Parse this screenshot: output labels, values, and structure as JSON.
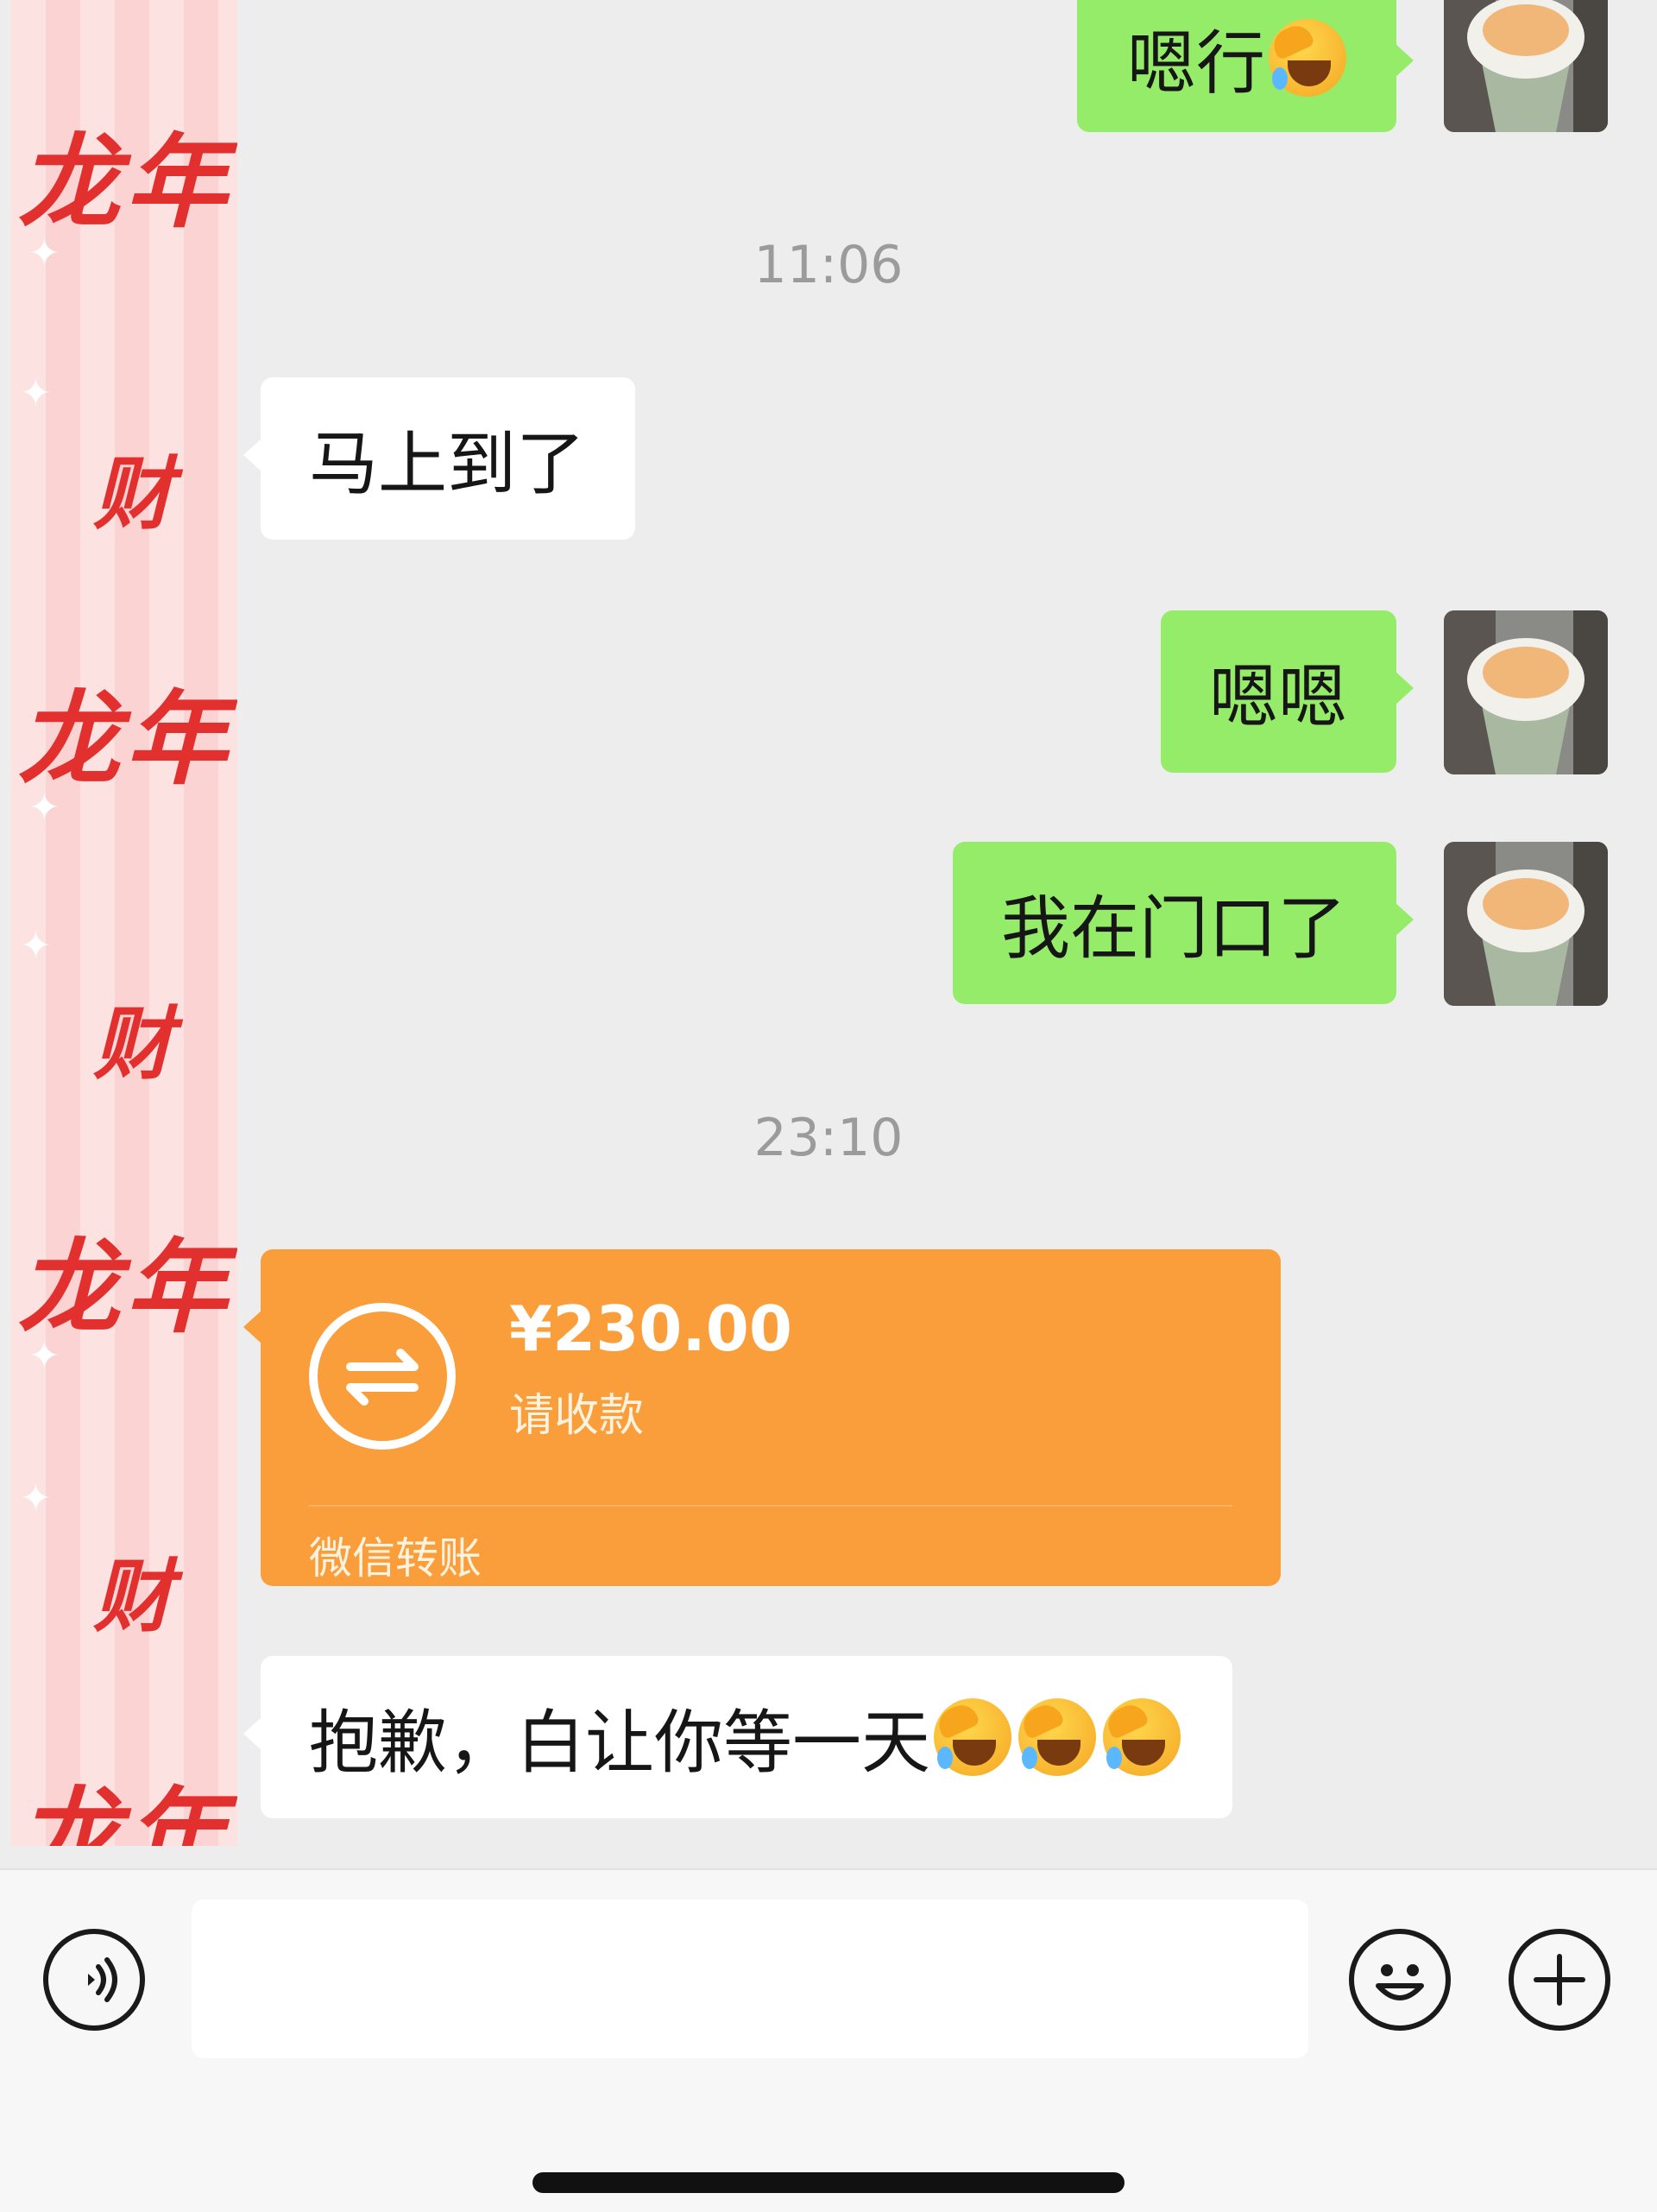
{
  "contact_avatar": {
    "line1": "龙年",
    "line2": "财",
    "sparkle": "✦"
  },
  "timestamps": [
    "11:06",
    "23:10"
  ],
  "messages": [
    {
      "side": "out",
      "text": "嗯行"
    },
    {
      "side": "in",
      "text": "马上到了"
    },
    {
      "side": "out",
      "text": "嗯嗯"
    },
    {
      "side": "out",
      "text": "我在门口了"
    },
    {
      "side": "in",
      "text": "抱歉，白让你等一天"
    }
  ],
  "transfer": {
    "amount": "¥230.00",
    "status": "请收款",
    "footer": "微信转账"
  },
  "icons": {
    "voice": "voice-icon",
    "emoji": "emoji-icon",
    "plus": "plus-icon",
    "emoji_sticker": "rolling-laughing-emoji-icon"
  },
  "colors": {
    "background": "#ededed",
    "bubble_out": "#95ec69",
    "bubble_in": "#ffffff",
    "transfer": "#fa9d3b",
    "deco_red": "#e2302f"
  }
}
